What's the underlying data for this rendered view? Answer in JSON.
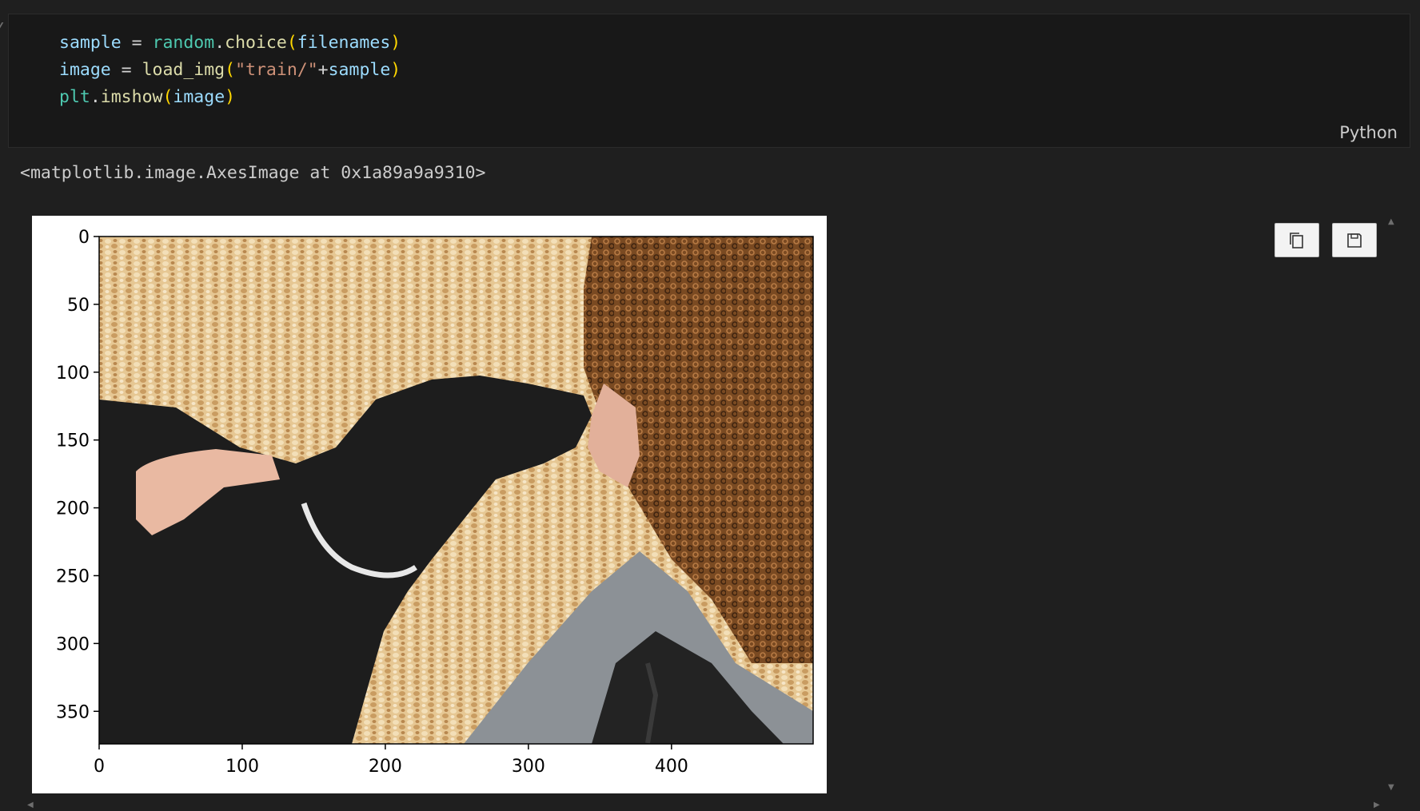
{
  "code_cell": {
    "language": "Python",
    "lines": [
      {
        "tokens": [
          {
            "t": "sample",
            "c": "var"
          },
          {
            "t": " = ",
            "c": "op"
          },
          {
            "t": "random",
            "c": "mod"
          },
          {
            "t": ".",
            "c": "op"
          },
          {
            "t": "choice",
            "c": "fn"
          },
          {
            "t": "(",
            "c": "paren"
          },
          {
            "t": "filenames",
            "c": "var"
          },
          {
            "t": ")",
            "c": "paren"
          }
        ]
      },
      {
        "tokens": [
          {
            "t": "image",
            "c": "var"
          },
          {
            "t": " = ",
            "c": "op"
          },
          {
            "t": "load_img",
            "c": "fn"
          },
          {
            "t": "(",
            "c": "paren"
          },
          {
            "t": "\"train/\"",
            "c": "str"
          },
          {
            "t": "+",
            "c": "op"
          },
          {
            "t": "sample",
            "c": "var"
          },
          {
            "t": ")",
            "c": "paren"
          }
        ]
      },
      {
        "tokens": [
          {
            "t": "plt",
            "c": "mod"
          },
          {
            "t": ".",
            "c": "op"
          },
          {
            "t": "imshow",
            "c": "fn"
          },
          {
            "t": "(",
            "c": "paren"
          },
          {
            "t": "image",
            "c": "var"
          },
          {
            "t": ")",
            "c": "paren"
          }
        ]
      }
    ]
  },
  "output": {
    "text": "<matplotlib.image.AxesImage at 0x1a89a9a9310>",
    "buttons": {
      "copy_icon": "copy-icon",
      "save_icon": "save-icon"
    }
  },
  "chart_data": {
    "type": "image",
    "description_visible": "photo of black dog touching nose with curly-haired woman",
    "xlim": [
      0,
      499
    ],
    "ylim": [
      374,
      0
    ],
    "xticks": [
      0,
      100,
      200,
      300,
      400
    ],
    "yticks": [
      0,
      50,
      100,
      150,
      200,
      250,
      300,
      350
    ],
    "xtick_labels": [
      "0",
      "100",
      "200",
      "300",
      "400"
    ],
    "ytick_labels": [
      "0",
      "50",
      "100",
      "150",
      "200",
      "250",
      "300",
      "350"
    ]
  },
  "colors": {
    "background": "#1f1f1f",
    "cell_bg": "#181818",
    "gravel": "#e3c38f",
    "dog": "#1c1c1c",
    "hair": "#8a5a2e",
    "jacket": "#8c9196"
  }
}
